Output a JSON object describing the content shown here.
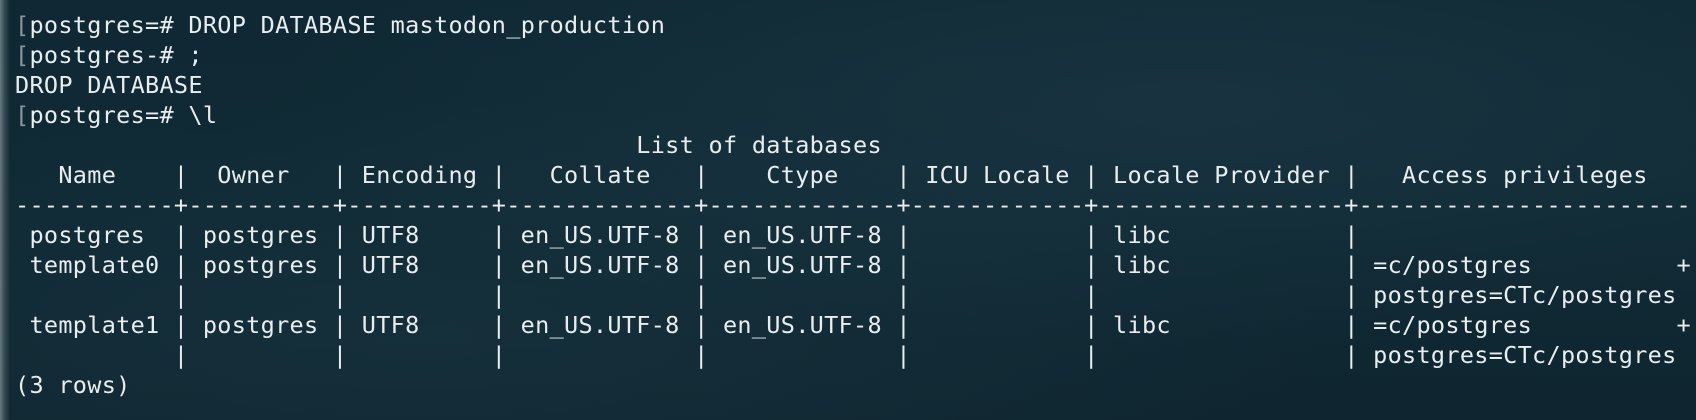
{
  "terminal": {
    "lines": [
      {
        "bracket": "[",
        "text": "postgres=# DROP DATABASE mastodon_production"
      },
      {
        "bracket": "[",
        "text": "postgres-# ;"
      },
      {
        "bracket": "",
        "text": "DROP DATABASE"
      },
      {
        "bracket": "[",
        "text": "postgres=# \\l"
      },
      {
        "bracket": "",
        "text": "                                           List of databases"
      },
      {
        "bracket": "",
        "text": "   Name    |  Owner   | Encoding |   Collate   |    Ctype    | ICU Locale | Locale Provider |   Access privileges"
      },
      {
        "bracket": "",
        "text": "-----------+----------+----------+-------------+-------------+------------+-----------------+-----------------------"
      },
      {
        "bracket": "",
        "text": " postgres  | postgres | UTF8     | en_US.UTF-8 | en_US.UTF-8 |            | libc            |"
      },
      {
        "bracket": "",
        "text": " template0 | postgres | UTF8     | en_US.UTF-8 | en_US.UTF-8 |            | libc            | =c/postgres          +"
      },
      {
        "bracket": "",
        "text": "           |          |          |             |             |            |                 | postgres=CTc/postgres"
      },
      {
        "bracket": "",
        "text": " template1 | postgres | UTF8     | en_US.UTF-8 | en_US.UTF-8 |            | libc            | =c/postgres          +"
      },
      {
        "bracket": "",
        "text": "           |          |          |             |             |            |                 | postgres=CTc/postgres"
      },
      {
        "bracket": "",
        "text": "(3 rows)"
      }
    ]
  },
  "colors": {
    "background": "#0f2731",
    "foreground": "#e8eef0",
    "bracket": "#8a979c"
  }
}
